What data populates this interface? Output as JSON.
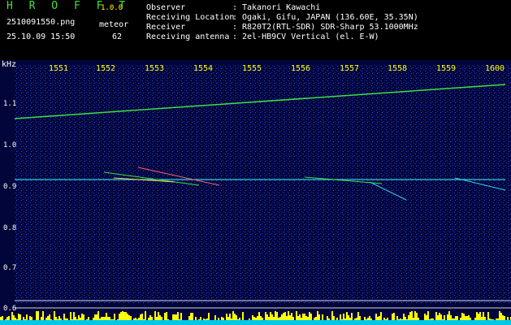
{
  "header": {
    "logo": "H R O F F T",
    "version": "1.0.0",
    "filename": "2510091550.png",
    "meteor_label": "meteor",
    "datetime": "25.10.09 15:50",
    "meteor_count": "62",
    "meta": [
      {
        "label": "Observer",
        "value": "Takanori Kawachi"
      },
      {
        "label": "Receiving Location",
        "value": "Ogaki, Gifu, JAPAN (136.60E, 35.35N)"
      },
      {
        "label": "Receiver",
        "value": "R820T2(RTL-SDR) SDR-Sharp 53.1000MHz"
      },
      {
        "label": "Receiving antenna",
        "value": "2el-HB9CV Vertical (el. E-W)"
      }
    ]
  },
  "spectrogram": {
    "y_unit": "kHz",
    "y_ticks": [
      "1.1",
      "1.0",
      "0.9",
      "0.8",
      "0.7",
      "0.6"
    ],
    "x_ticks": [
      "1551",
      "1552",
      "1553",
      "1554",
      "1555",
      "1556",
      "1557",
      "1558",
      "1559",
      "1600"
    ],
    "colors": {
      "background": "#02053a",
      "trace": "#3fe03f",
      "meteor": "#ff6060",
      "axis_text": "#ffff00"
    }
  }
}
